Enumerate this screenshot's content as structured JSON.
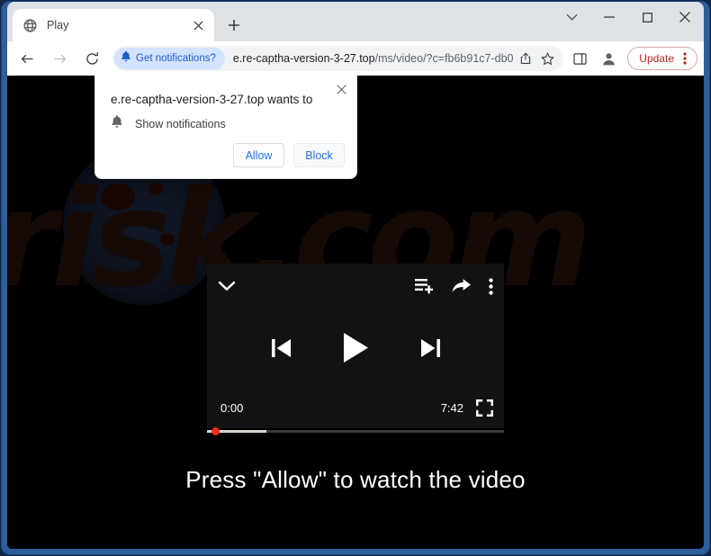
{
  "window": {
    "controls": [
      {
        "name": "tab-search",
        "icon": "chevron-down-icon",
        "label": "∨"
      },
      {
        "name": "minimize",
        "icon": "minimize-icon",
        "label": "—"
      },
      {
        "name": "maximize",
        "icon": "maximize-icon",
        "label": "□"
      },
      {
        "name": "close",
        "icon": "close-icon",
        "label": "✕"
      }
    ]
  },
  "tabs": [
    {
      "title": "Play",
      "favicon": "globe-icon",
      "close_label": "✕"
    }
  ],
  "new_tab": {
    "label": "+",
    "tooltip": "New tab"
  },
  "toolbar": {
    "back_label": "←",
    "forward_label": "→",
    "reload_label": "⟳",
    "notification_chip": {
      "label": "Get notifications?",
      "icon": "bell-icon",
      "bg_color": "#d3e3fd",
      "text_color": "#1a5fd0"
    },
    "url_host": "e.re-captha-version-3-27.top",
    "url_path": "/ms/video/?c=fb6b91c7-db0…",
    "share_icon": "share-box-icon",
    "bookmark_icon": "star-icon",
    "side_panel_icon": "side-panel-icon",
    "profile_icon": "person-icon",
    "update": {
      "label": "Update",
      "color": "#b3261e",
      "menu_icon": "three-dots-vertical-icon"
    }
  },
  "page": {
    "watermark": "risk.com",
    "headline": "Press \"Allow\" to watch the video"
  },
  "player": {
    "collapse_icon": "chevron-down-icon",
    "playlist_add_icon": "playlist-add-icon",
    "share_icon": "share-arrow-icon",
    "more_icon": "three-dots-vertical-icon",
    "previous_icon": "skip-previous-icon",
    "play_icon": "play-icon",
    "next_icon": "skip-next-icon",
    "current_time": "0:00",
    "duration": "7:42",
    "fullscreen_icon": "fullscreen-icon",
    "progress_percent": 0,
    "buffered_percent": 20,
    "accent_color": "#f52a1d"
  },
  "permission_dialog": {
    "title": "e.re-captha-version-3-27.top wants to",
    "permission_icon": "bell-icon",
    "permission_label": "Show notifications",
    "allow_label": "Allow",
    "block_label": "Block",
    "close_label": "✕"
  }
}
